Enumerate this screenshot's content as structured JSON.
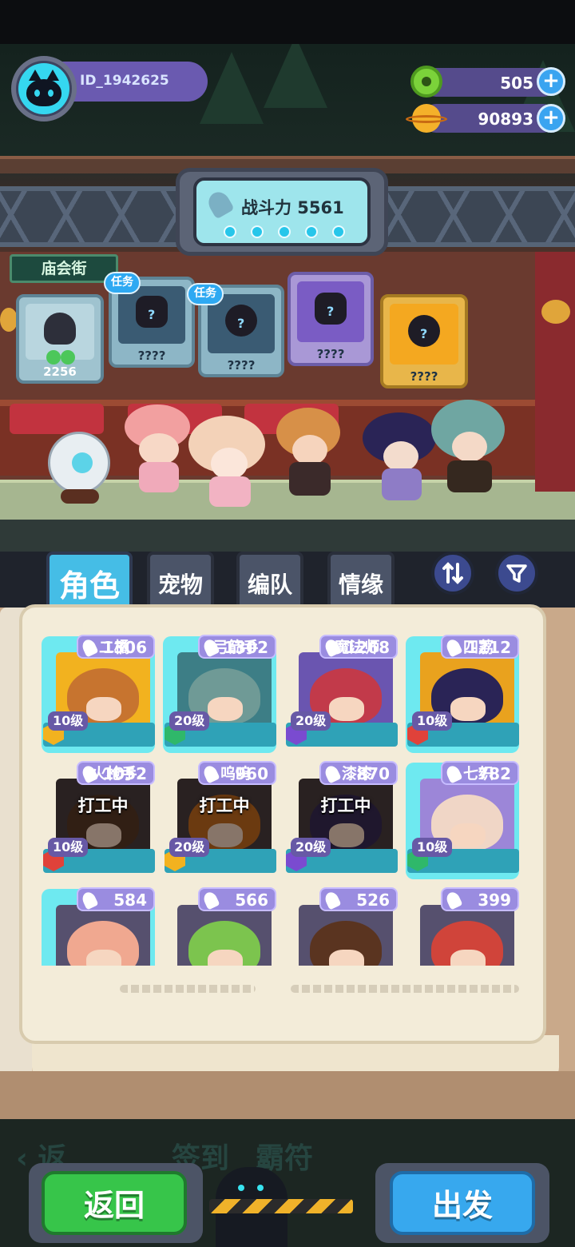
{
  "player": {
    "id": "ID_1942625",
    "avatar_icon": "cat-icon"
  },
  "currencies": [
    {
      "name": "gem",
      "value": "505",
      "icon": "green-ring-gem-icon"
    },
    {
      "name": "coin",
      "value": "90893",
      "icon": "planet-coin-icon"
    }
  ],
  "combat_power": {
    "label": "战斗力 5561",
    "dots": 5
  },
  "location": "庙会街",
  "collection": [
    {
      "label": "2256",
      "task": ""
    },
    {
      "label": "????",
      "task": "任务"
    },
    {
      "label": "????",
      "task": "任务"
    },
    {
      "label": "????",
      "task": ""
    },
    {
      "label": "????",
      "task": ""
    }
  ],
  "tabs": [
    {
      "label": "角色",
      "active": true
    },
    {
      "label": "宠物",
      "active": false
    },
    {
      "label": "编队",
      "active": false
    },
    {
      "label": "情缘",
      "active": false
    }
  ],
  "toolbar": {
    "sort_icon": "sort-icon",
    "filter_icon": "filter-icon"
  },
  "characters": [
    {
      "power": "1306",
      "level": "10级",
      "name": "二橘",
      "status": "",
      "class_color": "#f2b21f"
    },
    {
      "power": "1302",
      "level": "20级",
      "name": "弓箭手",
      "status": "",
      "class_color": "#2fb86a"
    },
    {
      "power": "1268",
      "level": "20级",
      "name": "魔法师",
      "status": "",
      "class_color": "#7a4bd0"
    },
    {
      "power": "1212",
      "level": "10级",
      "name": "四荔",
      "status": "",
      "class_color": "#e0423a"
    },
    {
      "power": "1052",
      "level": "10级",
      "name": "火枪手",
      "status": "打工中",
      "class_color": "#e0423a"
    },
    {
      "power": "960",
      "level": "20级",
      "name": "呜呜",
      "status": "打工中",
      "class_color": "#f2b21f"
    },
    {
      "power": "870",
      "level": "20级",
      "name": "漆漆",
      "status": "打工中",
      "class_color": "#7a4bd0"
    },
    {
      "power": "782",
      "level": "10级",
      "name": "七织",
      "status": "",
      "class_color": "#2fb86a"
    },
    {
      "power": "584",
      "level": "",
      "name": "",
      "status": ""
    },
    {
      "power": "566",
      "level": "",
      "name": "",
      "status": ""
    },
    {
      "power": "526",
      "level": "",
      "name": "",
      "status": ""
    },
    {
      "power": "399",
      "level": "",
      "name": "",
      "status": ""
    }
  ],
  "buttons": {
    "back": "返回",
    "go": "出发"
  }
}
